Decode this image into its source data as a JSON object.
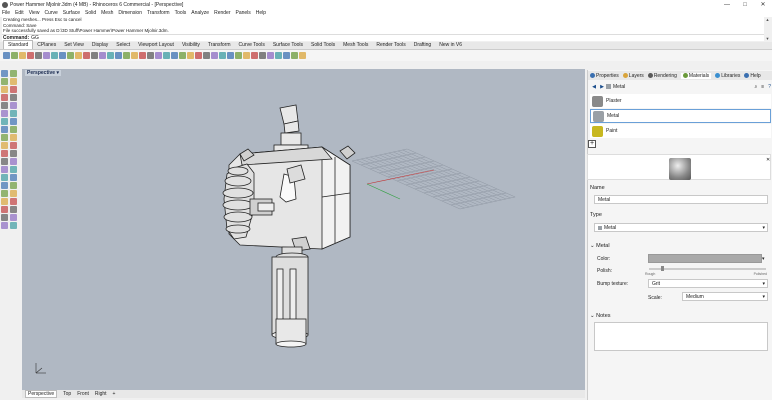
{
  "window": {
    "title": "Power Hammer Mjolnir.3dm (4 MB) - Rhinoceros 6 Commercial - [Perspective]",
    "controls": [
      "—",
      "□",
      "✕"
    ]
  },
  "menu": [
    "File",
    "Edit",
    "View",
    "Curve",
    "Surface",
    "Solid",
    "Mesh",
    "Dimension",
    "Transform",
    "Tools",
    "Analyze",
    "Render",
    "Panels",
    "Help"
  ],
  "command_history": [
    "Creating meshes... Press Esc to cancel",
    "Command: Save",
    "File successfully saved as D:\\3D Stuff\\Power Hammer\\Power Hammer Mjolnir.3dm."
  ],
  "command_line": {
    "label": "Command:",
    "value": "GG"
  },
  "toolbar_tabs": [
    "Standard",
    "CPlanes",
    "Set View",
    "Display",
    "Select",
    "Viewport Layout",
    "Visibility",
    "Transform",
    "Curve Tools",
    "Surface Tools",
    "Solid Tools",
    "Mesh Tools",
    "Render Tools",
    "Drafting",
    "New in V6"
  ],
  "viewport": {
    "label": "Perspective",
    "dropdown": "▾"
  },
  "bottom_tabs": [
    "Perspective",
    "Top",
    "Front",
    "Right",
    "+"
  ],
  "panel": {
    "tabs": [
      {
        "label": "Properties",
        "color": "#3a6fb0"
      },
      {
        "label": "Layers",
        "color": "#d9a43a"
      },
      {
        "label": "Rendering",
        "color": "#5a5a5a"
      },
      {
        "label": "Materials",
        "color": "#6a9a3a"
      },
      {
        "label": "Libraries",
        "color": "#3a8fd0"
      },
      {
        "label": "Help",
        "color": "#3a6fb0"
      }
    ],
    "breadcrumb": "Metal",
    "materials": [
      {
        "name": "Plaster",
        "thumb": "#8a8a8a"
      },
      {
        "name": "Metal",
        "thumb": "#9aa0a6"
      },
      {
        "name": "Paint",
        "thumb": "#c8b820"
      }
    ],
    "add_button": "+",
    "name_section": {
      "label": "Name",
      "value": "Metal"
    },
    "type_section": {
      "label": "Type",
      "value": "Metal"
    },
    "metal_section": {
      "header": "Metal",
      "color_label": "Color:",
      "color_value": "#a9a9a9",
      "polish_label": "Polish:",
      "polish_low": "Rough",
      "polish_high": "Polished",
      "polish_level": 0.1,
      "bump_label": "Bump texture:",
      "bump_value": "Grit",
      "scale_label": "Scale:",
      "scale_value": "Medium"
    },
    "notes_header": "Notes"
  },
  "colors": {
    "viewport_bg": "#b0b8c3",
    "grid": "#8a909a",
    "axis_x": "#c03030",
    "axis_y": "#30a040",
    "accent": "#1a4d8c"
  }
}
